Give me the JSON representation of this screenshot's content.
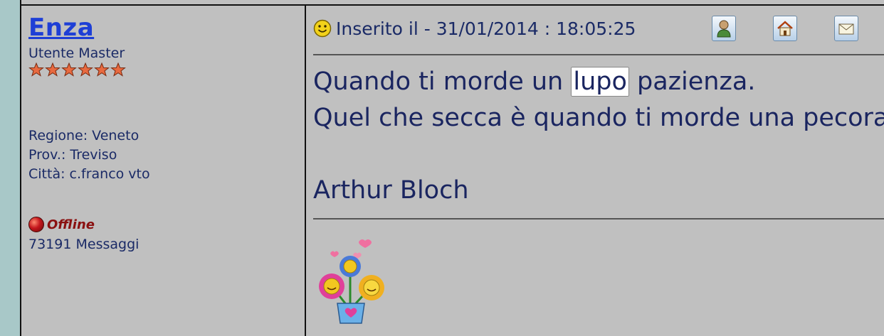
{
  "author": {
    "name": "Enza",
    "rank": "Utente Master",
    "star_count": 6,
    "region": "Regione: Veneto",
    "province": "Prov.: Treviso",
    "city": "Città: c.franco vto",
    "status": "Offline",
    "posts": "73191 Messaggi"
  },
  "post": {
    "date_label": "Inserito il - 31/01/2014 : 18:05:25",
    "line1_before": "Quando ti morde un ",
    "line1_highlight": "lupo",
    "line1_after": " pazienza.",
    "line2": "Quel che secca è quando ti morde una pecora.",
    "signature": "Arthur Bloch"
  },
  "toolbar": {
    "icons": [
      "profile-icon",
      "home-icon",
      "email-icon",
      "arrow-icon"
    ]
  },
  "colors": {
    "background": "#c0c0c0",
    "link": "#1e3fd6",
    "text": "#1a2a66",
    "offline": "#8a1010"
  }
}
